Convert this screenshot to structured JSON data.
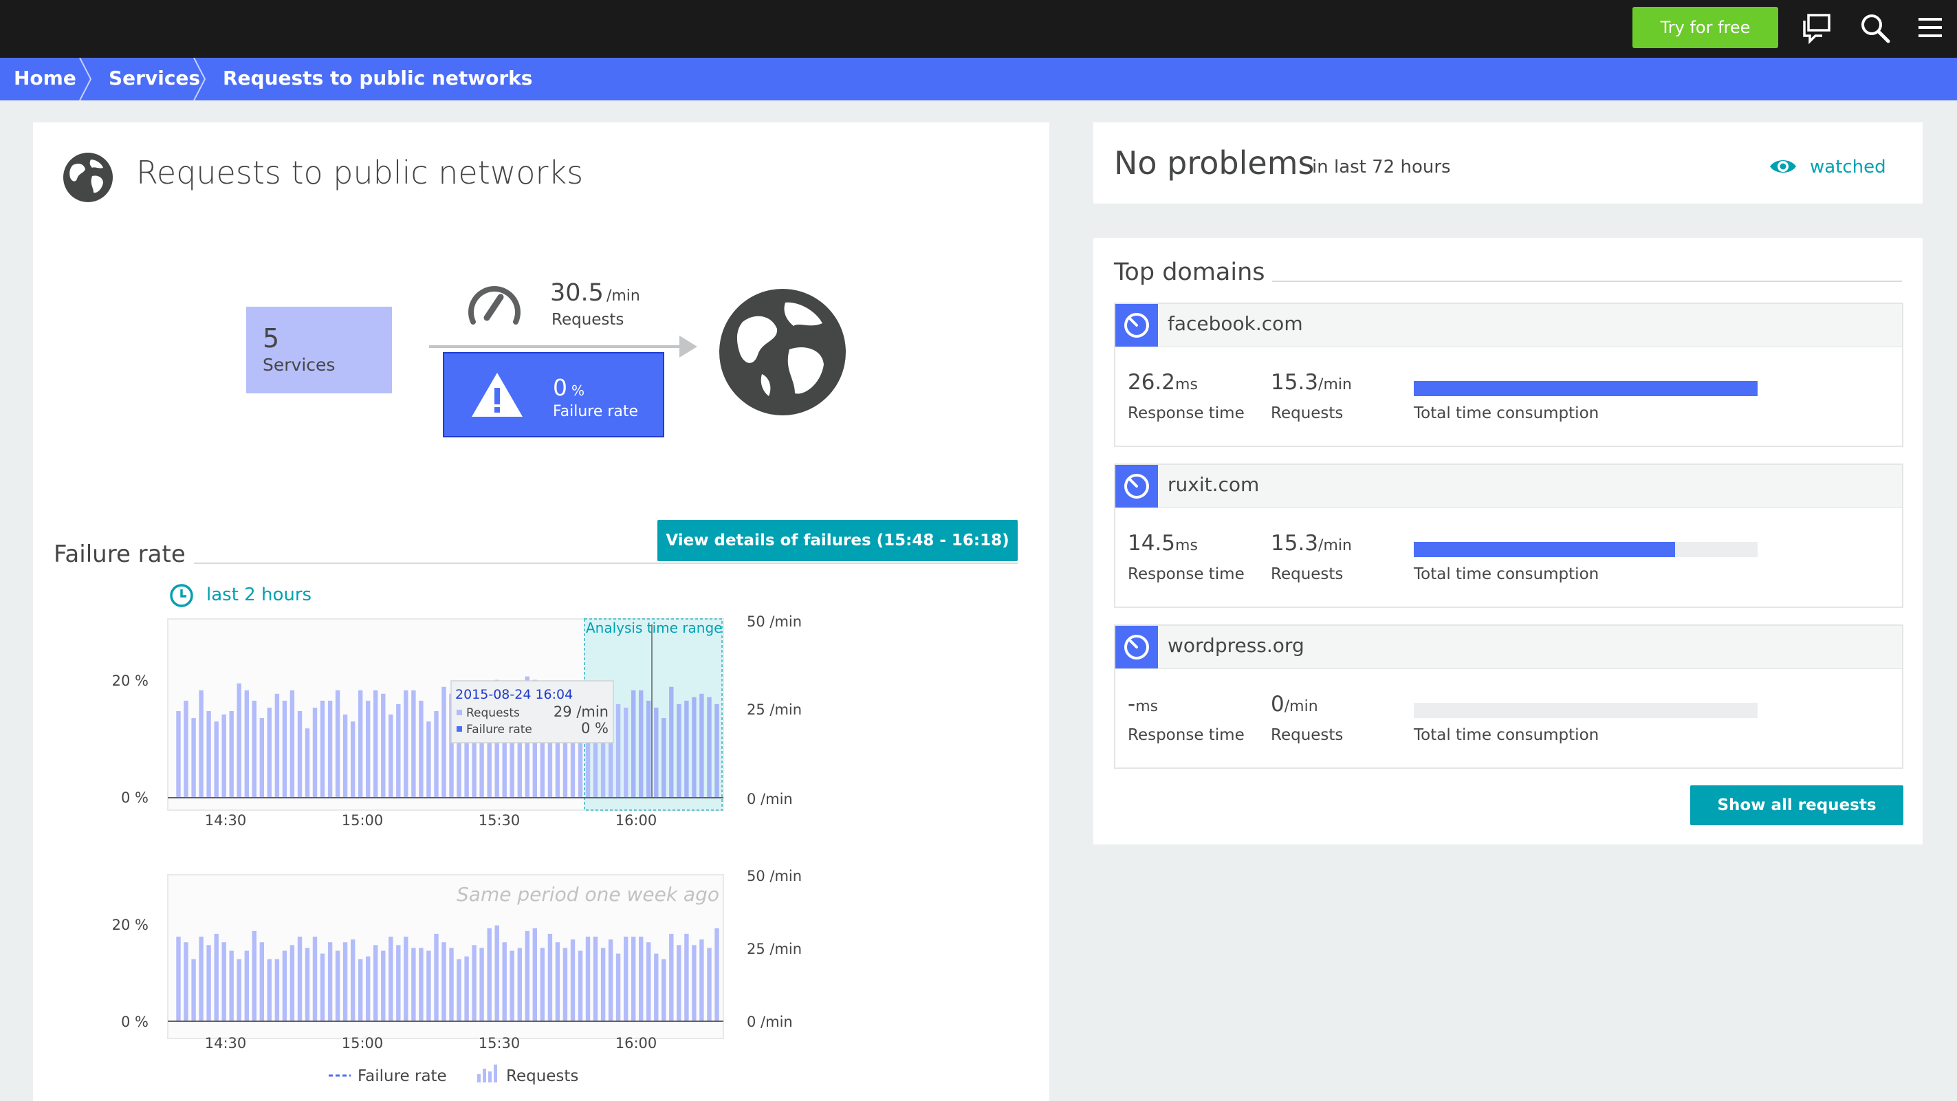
{
  "topbar": {
    "try_label": "Try for free",
    "icons": [
      "chat-icon",
      "search-icon",
      "menu-icon"
    ]
  },
  "breadcrumb": {
    "home": "Home",
    "services": "Services",
    "current": "Requests to public networks"
  },
  "main": {
    "title": "Requests to public networks",
    "services_count": "5",
    "services_label": "Services",
    "requests_value": "30.5",
    "requests_unit": "/min",
    "requests_label": "Requests",
    "failure_value": "0",
    "failure_unit": "%",
    "failure_label": "Failure rate",
    "view_failures_label": "View details of failures (15:48 - 16:18)",
    "section_title": "Failure rate",
    "timeframe_label": "last 2 hours"
  },
  "chart_top": {
    "analysis_label": "Analysis time range",
    "tooltip": {
      "date": "2015-08-24 16:04",
      "requests_label": "Requests",
      "requests_value": "29 /min",
      "failure_label": "Failure rate",
      "failure_value": "0 %"
    }
  },
  "chart_bottom": {
    "watermark": "Same period one week ago"
  },
  "legend": {
    "failure": "Failure rate",
    "requests": "Requests"
  },
  "chart_data": [
    {
      "type": "bar",
      "ylabel_left": [
        "20 %",
        "0 %"
      ],
      "yticks_right": [
        "50 /min",
        "25 /min",
        "0 /min"
      ],
      "xticks": [
        "14:30",
        "15:00",
        "15:30",
        "16:00"
      ],
      "ylim_right": [
        0,
        50
      ],
      "series": [
        {
          "name": "Requests",
          "values": [
            25,
            28,
            23,
            31,
            25,
            22,
            24,
            25,
            33,
            31,
            28,
            23,
            26,
            30,
            28,
            31,
            25,
            20,
            26,
            28,
            28,
            31,
            24,
            22,
            31,
            28,
            31,
            30,
            24,
            27,
            31,
            31,
            28,
            22,
            25,
            32,
            30,
            25,
            26,
            28,
            21,
            33,
            34,
            25,
            29,
            24,
            35,
            34,
            26,
            30,
            27,
            23,
            31,
            25,
            26,
            28,
            27,
            26,
            27,
            26,
            31,
            31,
            28,
            26,
            23,
            32,
            27,
            28,
            29,
            30,
            29,
            27
          ]
        },
        {
          "name": "Failure rate",
          "values": [
            0,
            0,
            0,
            0,
            0,
            0,
            0,
            0,
            0,
            0,
            0,
            0,
            0,
            0,
            0,
            0,
            0,
            0,
            0,
            0,
            0,
            0,
            0,
            0,
            0,
            0,
            0,
            0,
            0,
            0,
            0,
            0,
            0,
            0,
            0,
            0,
            0,
            0,
            0,
            0,
            0,
            0,
            0,
            0,
            0,
            0,
            0,
            0,
            0,
            0,
            0,
            0,
            0,
            0,
            0,
            0,
            0,
            0,
            0,
            0,
            0,
            0,
            0,
            0,
            0,
            0,
            0,
            0,
            0,
            0,
            0,
            0
          ]
        }
      ]
    },
    {
      "type": "bar",
      "ylabel_left": [
        "20 %",
        "0 %"
      ],
      "yticks_right": [
        "50 /min",
        "25 /min",
        "0 /min"
      ],
      "xticks": [
        "14:30",
        "15:00",
        "15:30",
        "16:00"
      ],
      "ylim_right": [
        0,
        50
      ],
      "series": [
        {
          "name": "Requests",
          "values": [
            30,
            28,
            22,
            30,
            27,
            31,
            28,
            25,
            22,
            25,
            32,
            28,
            22,
            22,
            25,
            27,
            30,
            26,
            30,
            24,
            28,
            25,
            28,
            29,
            22,
            23,
            27,
            25,
            30,
            27,
            30,
            26,
            26,
            25,
            31,
            28,
            26,
            22,
            23,
            27,
            26,
            33,
            34,
            28,
            25,
            26,
            32,
            33,
            26,
            31,
            28,
            26,
            29,
            25,
            30,
            30,
            26,
            29,
            24,
            30,
            30,
            30,
            28,
            24,
            22,
            31,
            27,
            31,
            27,
            29,
            26,
            33
          ]
        }
      ]
    }
  ],
  "problems": {
    "title": "No problems",
    "subtitle": "in last 72 hours",
    "watched_label": "watched"
  },
  "top_domains": {
    "title": "Top domains",
    "show_all_label": "Show all requests",
    "items": [
      {
        "name": "facebook.com",
        "response_value": "26.2",
        "response_unit": "ms",
        "response_label": "Response time",
        "requests_value": "15.3",
        "requests_unit": "/min",
        "requests_label": "Requests",
        "consumption_label": "Total time consumption",
        "consumption": 1.0
      },
      {
        "name": "ruxit.com",
        "response_value": "14.5",
        "response_unit": "ms",
        "response_label": "Response time",
        "requests_value": "15.3",
        "requests_unit": "/min",
        "requests_label": "Requests",
        "consumption_label": "Total time consumption",
        "consumption": 0.76
      },
      {
        "name": "wordpress.org",
        "response_value": "-",
        "response_unit": "ms",
        "response_label": "Response time",
        "requests_value": "0",
        "requests_unit": "/min",
        "requests_label": "Requests",
        "consumption_label": "Total time consumption",
        "consumption": 0.0
      }
    ]
  },
  "colors": {
    "topbar": "#1a1a1a",
    "breadcrumb": "#4b6ef8",
    "accent_green": "#6bcb2a",
    "accent_teal": "#00a1b2",
    "bar": "#b3bcfa",
    "bar_highlight": "#a6b3f7",
    "blue_box": "#4b6ef8",
    "services_box": "#b6bffa"
  }
}
